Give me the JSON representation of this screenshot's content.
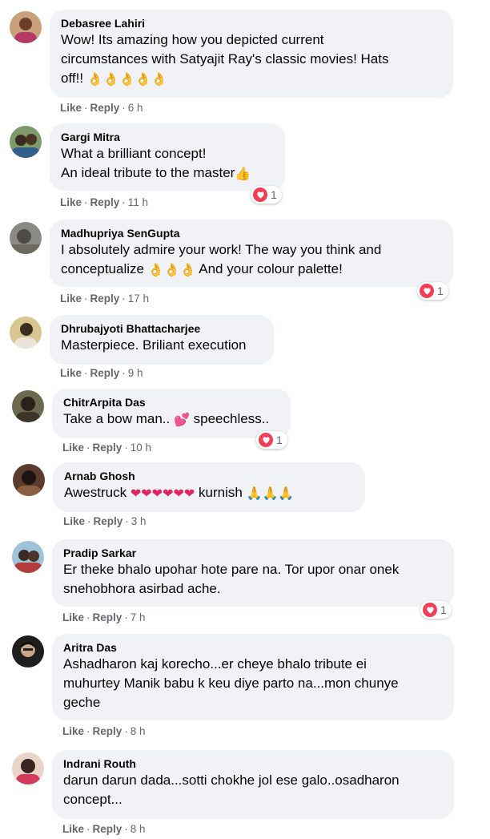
{
  "comments": [
    {
      "author": "Debasree Lahiri",
      "line1": "Wow! Its amazing how you depicted current",
      "line2": "circumstances with Satyajit Ray's classic movies! Hats",
      "line3": "off!!",
      "emojis": "👌👌👌👌👌",
      "like": "Like",
      "reply": "Reply",
      "time": "6 h"
    },
    {
      "author": "Gargi Mitra",
      "line1": "What a brilliant concept!",
      "line2": "An ideal tribute to the master",
      "emojis": "👍",
      "like": "Like",
      "reply": "Reply",
      "time": "11 h",
      "reactions": "1"
    },
    {
      "author": "Madhupriya SenGupta",
      "line1": "I absolutely admire your work! The way you think and",
      "line2": "conceptualize",
      "emojis": "👌👌👌",
      "line2b": "And your colour palette!",
      "like": "Like",
      "reply": "Reply",
      "time": "17 h",
      "reactions": "1"
    },
    {
      "author": "Dhrubajyoti Bhattacharjee",
      "line1": "Masterpiece. Briliant execution",
      "like": "Like",
      "reply": "Reply",
      "time": "9 h"
    },
    {
      "author": "ChitrArpita Das",
      "line1": "Take a bow man..",
      "emojis": "💕",
      "line1b": "speechless..",
      "like": "Like",
      "reply": "Reply",
      "time": "10 h",
      "reactions": "1"
    },
    {
      "author": "Arnab Ghosh",
      "line1": "Awestruck",
      "emojis": "❤❤❤❤❤❤",
      "line1b": "kurnish",
      "emojis2": "🙏🙏🙏",
      "like": "Like",
      "reply": "Reply",
      "time": "3 h"
    },
    {
      "author": "Pradip Sarkar",
      "line1": "Er theke bhalo upohar hote pare na. Tor upor onar onek",
      "line2": "snehobhora asirbad ache.",
      "like": "Like",
      "reply": "Reply",
      "time": "7 h",
      "reactions": "1"
    },
    {
      "author": "Aritra Das",
      "line1": "Ashadharon kaj korecho...er cheye bhalo tribute ei",
      "line2": "muhurtey Manik babu k keu diye parto na...mon chunye",
      "line3": "geche",
      "like": "Like",
      "reply": "Reply",
      "time": "8 h"
    },
    {
      "author": "Indrani Routh",
      "line1": "darun darun dada...sotti chokhe jol ese galo..osadharon",
      "line2": "concept...",
      "like": "Like",
      "reply": "Reply",
      "time": "8 h"
    }
  ],
  "icons": {
    "reaction": "heart-icon"
  },
  "colors": {
    "bubble": "#f0f2f5",
    "meta": "#65676b",
    "heart": "#f33e58"
  }
}
